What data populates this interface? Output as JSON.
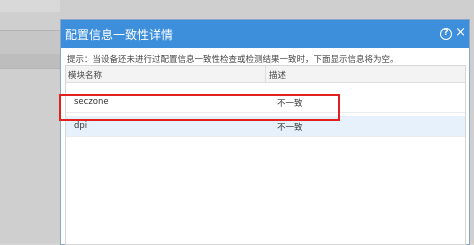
{
  "dialog": {
    "title": "配置信息一致性详情",
    "help_symbol": "?",
    "close_symbol": "×",
    "hint": "提示：当设备还未进行过配置信息一致性检查或检测结果一致时，下面显示信息将为空。"
  },
  "table": {
    "headers": [
      "模块名称",
      "描述"
    ],
    "rows": [
      {
        "name": "seczone",
        "desc": "不一致"
      },
      {
        "name": "dpi",
        "desc": "不一致"
      }
    ],
    "selected_row": 1
  },
  "colors": {
    "header_blue": "#3d8fdc",
    "selected_row": "#e6f1fb",
    "highlight_red": "#e32020"
  }
}
